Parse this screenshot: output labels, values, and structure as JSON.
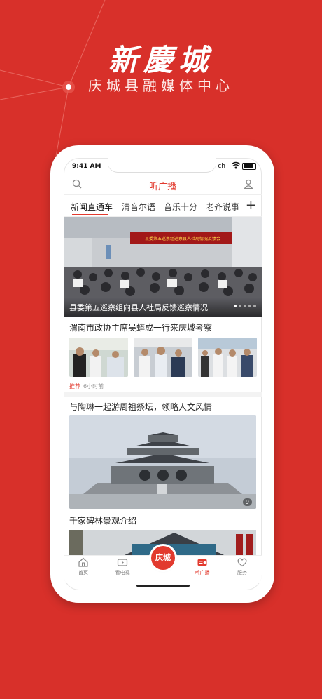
{
  "brand": {
    "title": "新慶城",
    "subtitle": "庆城县融媒体中心"
  },
  "status": {
    "time": "9:41 AM",
    "carrier": "ch"
  },
  "header": {
    "title": "听广播"
  },
  "tabs": [
    "新闻直通车",
    "清音尔语",
    "音乐十分",
    "老齐说事"
  ],
  "hero": {
    "caption": "县委第五巡察组向县人社局反馈巡察情况",
    "banner_text": "县委第五巡察组巡察县人社局情况反馈会"
  },
  "news1": {
    "title": "渭南市政协主席吴蟒成一行来庆城考察",
    "tag": "推荐",
    "time": "6小时前"
  },
  "news2": {
    "title": "与陶琳一起游周祖祭坛，领略人文风情",
    "image_count": "9"
  },
  "news3": {
    "title": "千家碑林景观介绍"
  },
  "tabbar": {
    "items": [
      {
        "label": "首页",
        "icon": "home-icon"
      },
      {
        "label": "看电视",
        "icon": "tv-icon"
      },
      {
        "label": "庆城",
        "icon": "logo"
      },
      {
        "label": "听广播",
        "icon": "radio-icon"
      },
      {
        "label": "服务",
        "icon": "heart-icon"
      }
    ]
  },
  "colors": {
    "accent": "#e23a2e",
    "background": "#d8302a"
  }
}
